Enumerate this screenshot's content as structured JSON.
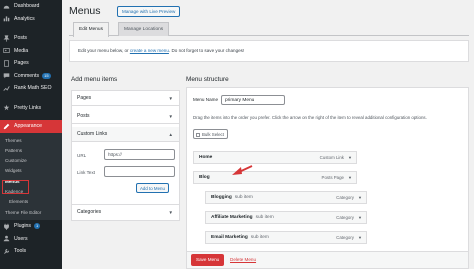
{
  "sidebar": {
    "items": [
      {
        "label": "Dashboard",
        "icon": "dashboard-icon"
      },
      {
        "label": "Analytics",
        "icon": "analytics-icon"
      },
      {
        "label": "Posts",
        "icon": "pin-icon"
      },
      {
        "label": "Media",
        "icon": "media-icon"
      },
      {
        "label": "Pages",
        "icon": "pages-icon"
      },
      {
        "label": "Comments",
        "icon": "comments-icon",
        "badge": "15"
      },
      {
        "label": "Rank Math SEO",
        "icon": "rank-math-icon"
      },
      {
        "label": "Pretty Links",
        "icon": "pretty-links-icon"
      },
      {
        "label": "Appearance",
        "icon": "appearance-icon"
      }
    ],
    "submenu": [
      "Themes",
      "Patterns",
      "Customize",
      "Widgets",
      "Menus",
      "Kadence",
      "Elements",
      "Theme File Editor"
    ],
    "bottom_items": [
      {
        "label": "Plugins",
        "icon": "plugins-icon",
        "badge": "1"
      },
      {
        "label": "Users",
        "icon": "users-icon"
      },
      {
        "label": "Tools",
        "icon": "tools-icon"
      }
    ]
  },
  "header": {
    "title": "Menus",
    "live_preview": "Manage with Live Preview"
  },
  "tabs": [
    "Edit Menus",
    "Manage Locations"
  ],
  "edit_bar": {
    "prefix": "Edit your menu below, or",
    "link": "create a new menu",
    "suffix": ". Do not forget to save your changes!"
  },
  "add_items": {
    "heading": "Add menu items",
    "sections": [
      "Pages",
      "Posts",
      "Custom Links",
      "Categories"
    ],
    "url_label": "URL",
    "url_value": "https://",
    "link_text_label": "Link Text",
    "add_button": "Add to Menu"
  },
  "structure": {
    "heading": "Menu structure",
    "name_label": "Menu Name",
    "name_value": "primary Menu",
    "help": "Drag the items into the order you prefer. Click the arrow on the right of the item to reveal additional configuration options.",
    "bulk_select": "Bulk Select",
    "items": [
      {
        "name": "Home",
        "sub": "",
        "type": "Custom Link"
      },
      {
        "name": "Blog",
        "sub": "",
        "type": "Posts Page"
      },
      {
        "name": "Blogging",
        "sub": "sub item",
        "type": "Category"
      },
      {
        "name": "Affiliate Marketing",
        "sub": "sub item",
        "type": "Category"
      },
      {
        "name": "Email Marketing",
        "sub": "sub item",
        "type": "Category"
      }
    ],
    "save_button": "Save Menu",
    "delete_link": "Delete Menu"
  },
  "colors": {
    "sidebar_bg": "#1d2327",
    "active": "#d63638",
    "link": "#2271b1",
    "callout_arrow": "#d63638"
  }
}
